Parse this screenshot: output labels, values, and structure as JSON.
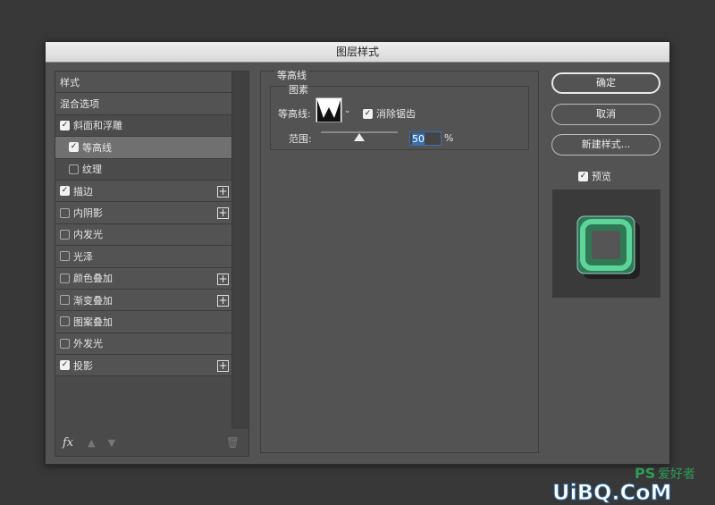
{
  "dialog": {
    "title": "图层样式"
  },
  "left_panel": {
    "header": "样式",
    "blend_options": "混合选项",
    "items": [
      {
        "label": "斜面和浮雕",
        "checked": true,
        "plus": false,
        "child": false,
        "state": "parent"
      },
      {
        "label": "等高线",
        "checked": true,
        "plus": false,
        "child": true,
        "state": "selected"
      },
      {
        "label": "纹理",
        "checked": false,
        "plus": false,
        "child": true,
        "state": "parent"
      },
      {
        "label": "描边",
        "checked": true,
        "plus": true,
        "child": false,
        "state": ""
      },
      {
        "label": "内阴影",
        "checked": false,
        "plus": true,
        "child": false,
        "state": ""
      },
      {
        "label": "内发光",
        "checked": false,
        "plus": false,
        "child": false,
        "state": ""
      },
      {
        "label": "光泽",
        "checked": false,
        "plus": false,
        "child": false,
        "state": ""
      },
      {
        "label": "颜色叠加",
        "checked": false,
        "plus": true,
        "child": false,
        "state": ""
      },
      {
        "label": "渐变叠加",
        "checked": false,
        "plus": true,
        "child": false,
        "state": ""
      },
      {
        "label": "图案叠加",
        "checked": false,
        "plus": false,
        "child": false,
        "state": ""
      },
      {
        "label": "外发光",
        "checked": false,
        "plus": false,
        "child": false,
        "state": ""
      },
      {
        "label": "投影",
        "checked": true,
        "plus": true,
        "child": false,
        "state": ""
      }
    ],
    "fx_label": "fx"
  },
  "contour": {
    "section_title": "等高线",
    "group_title": "图素",
    "contour_label": "等高线:",
    "anti_alias_label": "消除锯齿",
    "anti_alias_checked": true,
    "range_label": "范围:",
    "range_value": "50",
    "range_unit": "%",
    "range_fraction": 0.5
  },
  "buttons": {
    "ok": "确定",
    "cancel": "取消",
    "new_style": "新建样式..."
  },
  "preview": {
    "label": "预览",
    "checked": true
  },
  "watermark": {
    "ps": "PS",
    "site": "UiBQ.CoM",
    "cn": "爱好者"
  },
  "colors": {
    "preview_green": "#3e9a6a"
  }
}
